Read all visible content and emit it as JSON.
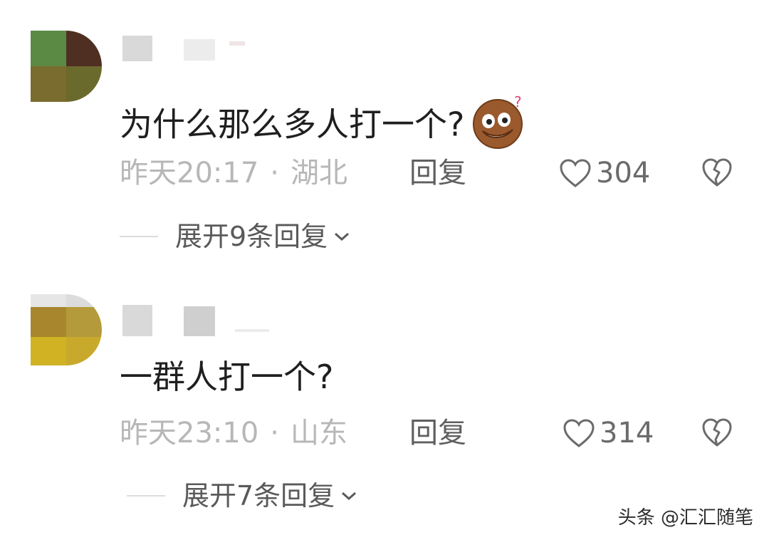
{
  "comments": [
    {
      "text": "为什么那么多人打一个?",
      "emoji": "confused-face-emoji",
      "time": "昨天20:17",
      "separator": "·",
      "location": "湖北",
      "reply_label": "回复",
      "likes": "304",
      "expand_label": "展开9条回复"
    },
    {
      "text": "一群人打一个?",
      "time": "昨天23:10",
      "separator": "·",
      "location": "山东",
      "reply_label": "回复",
      "likes": "314",
      "expand_label": "展开7条回复"
    }
  ],
  "watermark": "头条 @汇汇随笔",
  "icons": [
    "heart-icon",
    "broken-heart-icon",
    "chevron-down-icon"
  ],
  "colors": {
    "text": "#1f1f1f",
    "meta": "#b7b7b7",
    "action": "#5f5f5f"
  }
}
